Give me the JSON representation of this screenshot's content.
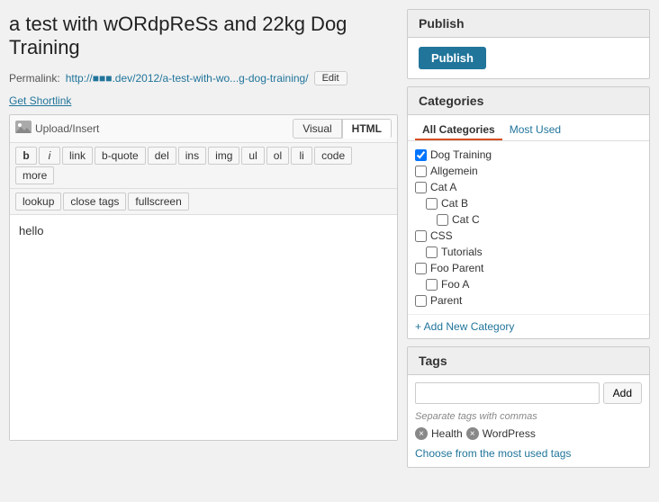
{
  "page": {
    "title": "a test with wORdpReSs and 22kg Dog Training"
  },
  "permalink": {
    "label": "Permalink:",
    "url": "http://■■■.dev/2012/a-test-with-wo...g-dog-training/",
    "edit_label": "Edit",
    "get_shortlink": "Get Shortlink"
  },
  "editor": {
    "upload_insert": "Upload/Insert",
    "view_visual": "Visual",
    "view_html": "HTML",
    "content": "hello",
    "toolbar": {
      "b": "b",
      "i": "i",
      "link": "link",
      "b_quote": "b-quote",
      "del": "del",
      "ins": "ins",
      "img": "img",
      "ul": "ul",
      "ol": "ol",
      "li": "li",
      "code": "code",
      "more": "more",
      "lookup": "lookup",
      "close_tags": "close tags",
      "fullscreen": "fullscreen"
    }
  },
  "publish": {
    "header": "Publish",
    "btn_label": "Publish"
  },
  "categories": {
    "header": "Categories",
    "tab_all": "All Categories",
    "tab_most_used": "Most Used",
    "add_new": "+ Add New Category",
    "items": [
      {
        "label": "Dog Training",
        "checked": true,
        "level": 0
      },
      {
        "label": "Allgemein",
        "checked": false,
        "level": 0
      },
      {
        "label": "Cat A",
        "checked": false,
        "level": 0
      },
      {
        "label": "Cat B",
        "checked": false,
        "level": 1
      },
      {
        "label": "Cat C",
        "checked": false,
        "level": 2
      },
      {
        "label": "CSS",
        "checked": false,
        "level": 0
      },
      {
        "label": "Tutorials",
        "checked": false,
        "level": 1
      },
      {
        "label": "Foo Parent",
        "checked": false,
        "level": 0
      },
      {
        "label": "Foo A",
        "checked": false,
        "level": 1
      },
      {
        "label": "Parent",
        "checked": false,
        "level": 0
      }
    ]
  },
  "tags": {
    "header": "Tags",
    "input_placeholder": "",
    "add_label": "Add",
    "hint": "Separate tags with commas",
    "items": [
      "Health",
      "WordPress"
    ],
    "choose_link": "Choose from the most used tags"
  }
}
